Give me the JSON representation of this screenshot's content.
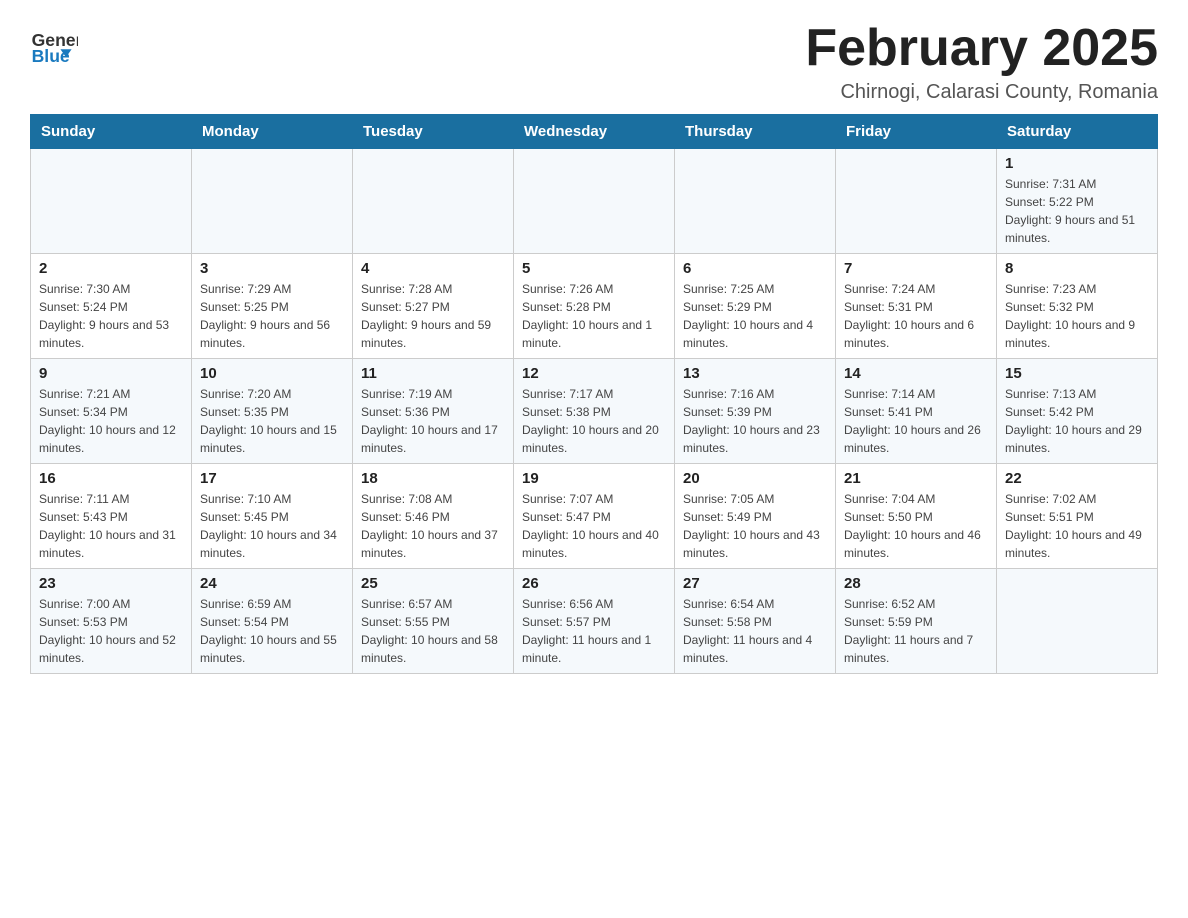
{
  "header": {
    "logo_line1": "General",
    "logo_line2": "Blue",
    "month_title": "February 2025",
    "location": "Chirnogi, Calarasi County, Romania"
  },
  "days_of_week": [
    "Sunday",
    "Monday",
    "Tuesday",
    "Wednesday",
    "Thursday",
    "Friday",
    "Saturday"
  ],
  "weeks": [
    [
      {
        "day": "",
        "info": ""
      },
      {
        "day": "",
        "info": ""
      },
      {
        "day": "",
        "info": ""
      },
      {
        "day": "",
        "info": ""
      },
      {
        "day": "",
        "info": ""
      },
      {
        "day": "",
        "info": ""
      },
      {
        "day": "1",
        "info": "Sunrise: 7:31 AM\nSunset: 5:22 PM\nDaylight: 9 hours and 51 minutes."
      }
    ],
    [
      {
        "day": "2",
        "info": "Sunrise: 7:30 AM\nSunset: 5:24 PM\nDaylight: 9 hours and 53 minutes."
      },
      {
        "day": "3",
        "info": "Sunrise: 7:29 AM\nSunset: 5:25 PM\nDaylight: 9 hours and 56 minutes."
      },
      {
        "day": "4",
        "info": "Sunrise: 7:28 AM\nSunset: 5:27 PM\nDaylight: 9 hours and 59 minutes."
      },
      {
        "day": "5",
        "info": "Sunrise: 7:26 AM\nSunset: 5:28 PM\nDaylight: 10 hours and 1 minute."
      },
      {
        "day": "6",
        "info": "Sunrise: 7:25 AM\nSunset: 5:29 PM\nDaylight: 10 hours and 4 minutes."
      },
      {
        "day": "7",
        "info": "Sunrise: 7:24 AM\nSunset: 5:31 PM\nDaylight: 10 hours and 6 minutes."
      },
      {
        "day": "8",
        "info": "Sunrise: 7:23 AM\nSunset: 5:32 PM\nDaylight: 10 hours and 9 minutes."
      }
    ],
    [
      {
        "day": "9",
        "info": "Sunrise: 7:21 AM\nSunset: 5:34 PM\nDaylight: 10 hours and 12 minutes."
      },
      {
        "day": "10",
        "info": "Sunrise: 7:20 AM\nSunset: 5:35 PM\nDaylight: 10 hours and 15 minutes."
      },
      {
        "day": "11",
        "info": "Sunrise: 7:19 AM\nSunset: 5:36 PM\nDaylight: 10 hours and 17 minutes."
      },
      {
        "day": "12",
        "info": "Sunrise: 7:17 AM\nSunset: 5:38 PM\nDaylight: 10 hours and 20 minutes."
      },
      {
        "day": "13",
        "info": "Sunrise: 7:16 AM\nSunset: 5:39 PM\nDaylight: 10 hours and 23 minutes."
      },
      {
        "day": "14",
        "info": "Sunrise: 7:14 AM\nSunset: 5:41 PM\nDaylight: 10 hours and 26 minutes."
      },
      {
        "day": "15",
        "info": "Sunrise: 7:13 AM\nSunset: 5:42 PM\nDaylight: 10 hours and 29 minutes."
      }
    ],
    [
      {
        "day": "16",
        "info": "Sunrise: 7:11 AM\nSunset: 5:43 PM\nDaylight: 10 hours and 31 minutes."
      },
      {
        "day": "17",
        "info": "Sunrise: 7:10 AM\nSunset: 5:45 PM\nDaylight: 10 hours and 34 minutes."
      },
      {
        "day": "18",
        "info": "Sunrise: 7:08 AM\nSunset: 5:46 PM\nDaylight: 10 hours and 37 minutes."
      },
      {
        "day": "19",
        "info": "Sunrise: 7:07 AM\nSunset: 5:47 PM\nDaylight: 10 hours and 40 minutes."
      },
      {
        "day": "20",
        "info": "Sunrise: 7:05 AM\nSunset: 5:49 PM\nDaylight: 10 hours and 43 minutes."
      },
      {
        "day": "21",
        "info": "Sunrise: 7:04 AM\nSunset: 5:50 PM\nDaylight: 10 hours and 46 minutes."
      },
      {
        "day": "22",
        "info": "Sunrise: 7:02 AM\nSunset: 5:51 PM\nDaylight: 10 hours and 49 minutes."
      }
    ],
    [
      {
        "day": "23",
        "info": "Sunrise: 7:00 AM\nSunset: 5:53 PM\nDaylight: 10 hours and 52 minutes."
      },
      {
        "day": "24",
        "info": "Sunrise: 6:59 AM\nSunset: 5:54 PM\nDaylight: 10 hours and 55 minutes."
      },
      {
        "day": "25",
        "info": "Sunrise: 6:57 AM\nSunset: 5:55 PM\nDaylight: 10 hours and 58 minutes."
      },
      {
        "day": "26",
        "info": "Sunrise: 6:56 AM\nSunset: 5:57 PM\nDaylight: 11 hours and 1 minute."
      },
      {
        "day": "27",
        "info": "Sunrise: 6:54 AM\nSunset: 5:58 PM\nDaylight: 11 hours and 4 minutes."
      },
      {
        "day": "28",
        "info": "Sunrise: 6:52 AM\nSunset: 5:59 PM\nDaylight: 11 hours and 7 minutes."
      },
      {
        "day": "",
        "info": ""
      }
    ]
  ]
}
